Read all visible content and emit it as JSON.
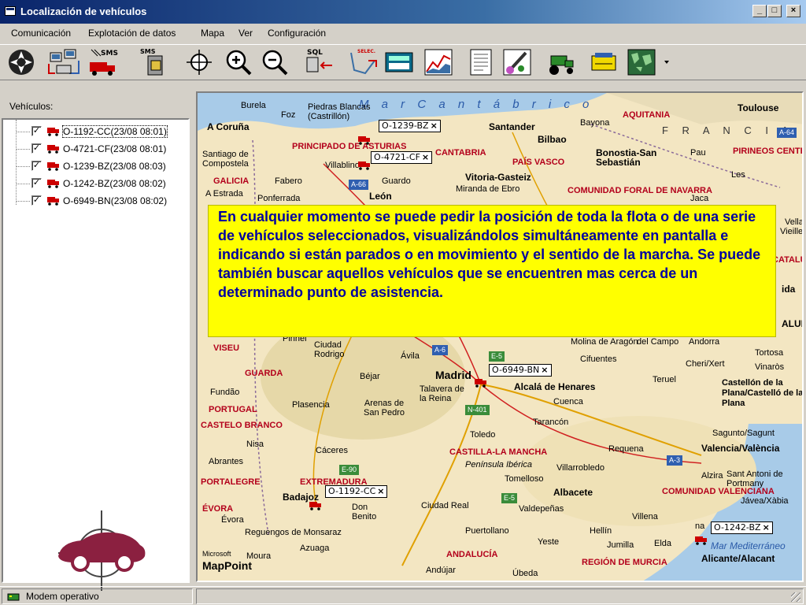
{
  "window": {
    "title": "Localización de vehículos",
    "min": "_",
    "max": "□",
    "close": "×"
  },
  "menu": [
    "Comunicación",
    "Explotación de datos",
    "Mapa",
    "Ver",
    "Configuración"
  ],
  "toolbar": [
    {
      "icon": "navigation-icon"
    },
    {
      "icon": "computers-link-icon"
    },
    {
      "icon": "sms-truck-icon",
      "text": "SMS"
    },
    {
      "icon": "sms-server-icon",
      "text": "SMS"
    },
    {
      "icon": "locate-crosshair-icon"
    },
    {
      "icon": "zoom-in-icon"
    },
    {
      "icon": "zoom-out-icon"
    },
    {
      "icon": "sql-query-icon",
      "text": "SQL"
    },
    {
      "icon": "select-route-icon",
      "text": "SELEC."
    },
    {
      "icon": "calculator-icon"
    },
    {
      "icon": "chart-icon"
    },
    {
      "icon": "document-list-icon"
    },
    {
      "icon": "paint-icon"
    },
    {
      "icon": "tractor-icon"
    },
    {
      "icon": "card-reader-icon"
    },
    {
      "icon": "world-map-icon"
    }
  ],
  "vehicles_label": "Vehículos:",
  "vehicles": [
    {
      "label": "O-1192-CC(23/08 08:01)",
      "checked": "✓"
    },
    {
      "label": "O-4721-CF(23/08 08:01)",
      "checked": "✓"
    },
    {
      "label": "O-1239-BZ(23/08 08:03)",
      "checked": "✓"
    },
    {
      "label": "O-1242-BZ(23/08 08:02)",
      "checked": "✓"
    },
    {
      "label": "O-6949-BN(23/08 08:02)",
      "checked": "✓"
    }
  ],
  "map": {
    "sea_north": "M a r   C a n t á b r i c o",
    "country": "F R A N C I A",
    "sea_east": "Mar Mediterráneo",
    "provider_small": "Microsoft",
    "provider": "MapPoint",
    "regions": [
      "PRINCIPADO DE ASTURIAS",
      "CANTABRIA",
      "PAÍS VASCO",
      "COMUNIDAD FORAL DE NAVARRA",
      "AQUITANIA",
      "PIRINEOS CENTRALES",
      "GALICIA",
      "VISEU",
      "GUARDA",
      "PORTUGAL",
      "CASTELO BRANCO",
      "PORTALEGRE",
      "ÉVORA",
      "EXTREMADURA",
      "CASTILLA-LA MANCHA",
      "COMUNIDAD VALENCIANA",
      "ANDALUCÍA",
      "REGIÓN DE MURCIA",
      "CATALUÑA"
    ],
    "cities": [
      "Burela",
      "Foz",
      "Piedras Blancas (Castrillón)",
      "A Coruña",
      "Santander",
      "Bilbao",
      "Bayona",
      "Toulouse",
      "Santiago de Compostela",
      "Villablino",
      "Vitoria-Gasteiz",
      "Bonostia-San Sebastián",
      "Pau",
      "Les",
      "Fabero",
      "Guardo",
      "Miranda de Ebro",
      "A Estrada",
      "Ponferrada",
      "León",
      "Jaca",
      "Ciudad Rodrigo",
      "Ávila",
      "Madrid",
      "Cifuentes",
      "Alcalá de Henares",
      "Molina de Aragón",
      "del Campo",
      "Andorra",
      "Tortosa",
      "Cheri/Xert",
      "Vinaròs",
      "Teruel",
      "Castellón de la Plana/Castelló de la Plana",
      "Fundão",
      "Plasencia",
      "Béjar",
      "Talavera de la Reina",
      "Arenas de San Pedro",
      "Cuenca",
      "Tarancón",
      "Toledo",
      "Nisa",
      "Cáceres",
      "Abrantes",
      "Sagunto/Sagunt",
      "Valencia/València",
      "Requena",
      "Alzira",
      "Sant Antoni de Portmany",
      "Jávea/Xàbia",
      "Península Ibérica",
      "Villarrobledo",
      "Tomelloso",
      "Albacete",
      "Badajoz",
      "Don Benito",
      "Ciudad Real",
      "Valdepeñas",
      "Évora",
      "Reguengos de Monsaraz",
      "Puertollano",
      "Villena",
      "Yeste",
      "Hellín",
      "Jumilla",
      "Elda",
      "Alicante/Alacant",
      "Moura",
      "Azuaga",
      "Andújar",
      "Úbeda",
      "Pinhel",
      "Vella",
      "Vieille",
      "ida",
      "ALUÑ",
      "na",
      "Alc"
    ],
    "roads": [
      "A-64",
      "A-66",
      "A-6",
      "E-5",
      "N-401",
      "E-90",
      "E-5",
      "A-3"
    ],
    "vehicle_tags": [
      "O-1239-BZ",
      "O-4721-CF",
      "O-6949-BN",
      "O-1192-CC",
      "O-1242-BZ"
    ],
    "tag_close": "×"
  },
  "callout": "En cualquier momento se puede pedir la posición de toda la flota o de una serie de vehículos seleccionados, visualizándolos simultáneamente en pantalla e indicando si están parados o en movimiento y el sentido de la marcha. Se puede también buscar aquellos vehículos que se encuentren mas cerca de un determinado punto de asistencia.",
  "status": {
    "text": "Modem operativo"
  },
  "colors": {
    "titlebar": "#0a246a",
    "callout_bg": "#ffff00",
    "callout_text": "#0000a0",
    "region_label": "#b3001b",
    "truck": "#cc0000"
  }
}
